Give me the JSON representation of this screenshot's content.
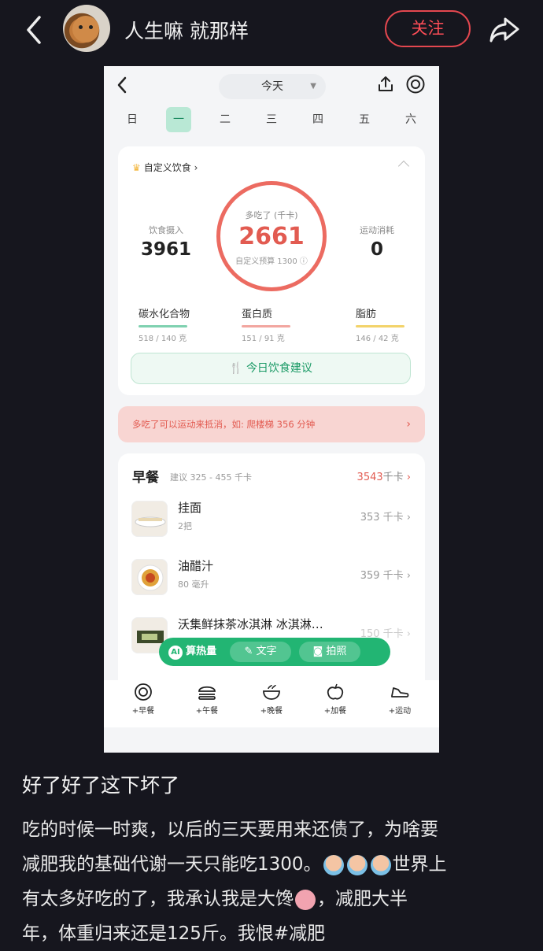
{
  "post": {
    "username": "人生嘛 就那样",
    "follow_label": "关注"
  },
  "screen": {
    "date_selector": "今天",
    "weekdays": [
      "日",
      "一",
      "二",
      "三",
      "四",
      "五",
      "六"
    ],
    "active_weekday": "一",
    "custom_diet": "自定义饮食",
    "intake_label": "饮食摄入",
    "intake_value": "3961",
    "over_label": "多吃了 (千卡)",
    "over_value": "2661",
    "budget_text": "自定义预算 1300",
    "exercise_label": "运动消耗",
    "exercise_value": "0",
    "macros": [
      {
        "name": "碳水化合物",
        "amount": "518 / 140 克",
        "color": "#7fd1b0"
      },
      {
        "name": "蛋白质",
        "amount": "151 / 91 克",
        "color": "#f2a6a0"
      },
      {
        "name": "脂肪",
        "amount": "146 / 42 克",
        "color": "#f3d36a"
      }
    ],
    "advice_button": "今日饮食建议",
    "exercise_banner": "多吃了可以运动来抵消，如: 爬楼梯 356 分钟",
    "meal": {
      "title": "早餐",
      "range": "建议 325 - 455 千卡",
      "total": "3543",
      "unit": "千卡"
    },
    "foods": [
      {
        "name": "挂面",
        "qty": "2把",
        "kcal": "353 千卡"
      },
      {
        "name": "油醋汁",
        "qty": "80 毫升",
        "kcal": "359 千卡"
      },
      {
        "name": "沃集鲜抹茶冰淇淋 冰淇淋…",
        "qty": "",
        "kcal": "150 千卡"
      }
    ],
    "ai_bar": {
      "ai": "AI",
      "calc": "算热量",
      "text": "文字",
      "photo": "拍照"
    },
    "tabs": [
      "+早餐",
      "+午餐",
      "+晚餐",
      "+加餐",
      "+运动"
    ]
  },
  "caption": {
    "title": "好了好了这下坏了",
    "line1": "吃的时候一时爽，以后的三天要用来还债了，为啥要",
    "line2a": "减肥我的基础代谢一天只能吃1300。",
    "line2b": "世界上",
    "line3a": "有太多好吃的了，我承认我是大馋",
    "line3b": "，减肥大半",
    "line4a": "年，体重归来还是125斤。我恨",
    "hashtag": "#减肥",
    "icons": {
      "cry": "crying-face-emoji",
      "pig": "pig-face-emoji"
    }
  }
}
